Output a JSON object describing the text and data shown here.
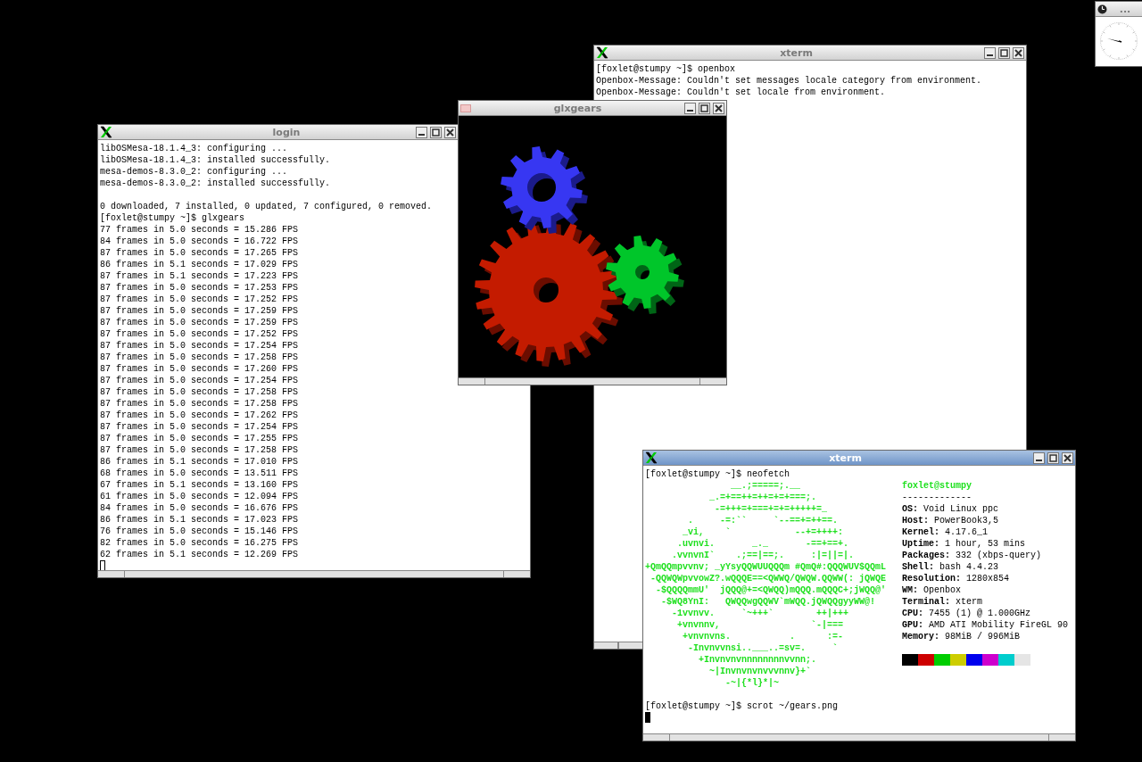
{
  "windows": [
    {
      "kind": "terminal",
      "title": "xterm",
      "active": false,
      "blocks": [
        [
          "[foxlet@stumpy ~]$ openbox",
          "Openbox-Message: Couldn't set messages locale category from environment.",
          "Openbox-Message: Couldn't set locale from environment."
        ]
      ]
    },
    {
      "kind": "terminal",
      "title": "login",
      "active": false,
      "cursor": true,
      "blocks": [
        [
          "libOSMesa-18.1.4_3: configuring ...",
          "libOSMesa-18.1.4_3: installed successfully.",
          "mesa-demos-8.3.0_2: configuring ...",
          "mesa-demos-8.3.0_2: installed successfully."
        ],
        [
          "0 downloaded, 7 installed, 0 updated, 7 configured, 0 removed.",
          "[foxlet@stumpy ~]$ glxgears",
          "77 frames in 5.0 seconds = 15.286 FPS",
          "84 frames in 5.0 seconds = 16.722 FPS",
          "87 frames in 5.0 seconds = 17.265 FPS",
          "86 frames in 5.1 seconds = 17.029 FPS",
          "87 frames in 5.1 seconds = 17.223 FPS",
          "87 frames in 5.0 seconds = 17.253 FPS",
          "87 frames in 5.0 seconds = 17.252 FPS",
          "87 frames in 5.0 seconds = 17.259 FPS",
          "87 frames in 5.0 seconds = 17.259 FPS",
          "87 frames in 5.0 seconds = 17.252 FPS",
          "87 frames in 5.0 seconds = 17.254 FPS",
          "87 frames in 5.0 seconds = 17.258 FPS",
          "87 frames in 5.0 seconds = 17.260 FPS",
          "87 frames in 5.0 seconds = 17.254 FPS",
          "87 frames in 5.0 seconds = 17.258 FPS",
          "87 frames in 5.0 seconds = 17.258 FPS",
          "87 frames in 5.0 seconds = 17.262 FPS",
          "87 frames in 5.0 seconds = 17.254 FPS",
          "87 frames in 5.0 seconds = 17.255 FPS",
          "87 frames in 5.0 seconds = 17.258 FPS",
          "86 frames in 5.1 seconds = 17.010 FPS",
          "68 frames in 5.0 seconds = 13.511 FPS",
          "67 frames in 5.1 seconds = 13.160 FPS",
          "61 frames in 5.0 seconds = 12.094 FPS",
          "84 frames in 5.0 seconds = 16.676 FPS",
          "86 frames in 5.1 seconds = 17.023 FPS",
          "76 frames in 5.0 seconds = 15.146 FPS",
          "82 frames in 5.0 seconds = 16.275 FPS",
          "62 frames in 5.1 seconds = 12.269 FPS"
        ]
      ]
    },
    {
      "kind": "gears",
      "title": "glxgears",
      "active": false
    },
    {
      "kind": "neofetch",
      "title": "xterm",
      "active": true,
      "cursor": true,
      "prompt": "[foxlet@stumpy ~]$ neofetch",
      "art": [
        "                __.;=====;.__",
        "            _.=+==++=++=+=+===;.",
        "             -=+++=+===+=+=+++++=_",
        "        .     -=:``     `--==+=++==.",
        "       _vi,    `            --+=++++:",
        "      .uvnvi.       _._       -==+==+.",
        "     .vvnvnI`    .;==|==;.     :|=||=|.",
        "+QmQQmpvvnv; _yYsyQQWUUQQQm #QmQ#:QQQWUV$QQmL",
        " -QQWQWpvvowZ?.wQQQE==<QWWQ/QWQW.QQWW(: jQWQE",
        "  -$QQQQmmU'  jQQQ@+=<QWQQ)mQQQ.mQQQC+;jWQQ@'",
        "   -$WQ8YnI:   QWQQwgQQWV`mWQQ.jQWQQgyyWW@!",
        "     -1vvnvv.     `~+++`        ++|+++",
        "      +vnvnnv,                 `-|===",
        "       +vnvnvns.           .      :=-",
        "        -Invnvvnsi..___..=sv=.     `",
        "          +Invnvnvnnnnnnnnvvnn;.",
        "            ~|Invnvnvnvvvnnv}+`",
        "               -~|{*l}*|~"
      ],
      "user": "foxlet@stumpy",
      "separator": "-------------",
      "info": [
        "**OS:** Void Linux ppc",
        "**Host:** PowerBook3,5",
        "**Kernel:** 4.17.6_1",
        "**Uptime:** 1 hour, 53 mins",
        "**Packages:** 332 (xbps-query)",
        "**Shell:** bash 4.4.23",
        "**Resolution:** 1280x854",
        "**WM:** Openbox",
        "**Terminal:** xterm",
        "**CPU:** 7455 (1) @ 1.000GHz",
        "**GPU:** AMD ATI Mobility FireGL 90",
        "**Memory:** 98MiB / 996MiB"
      ],
      "palette": [
        {
          "color": "#000000"
        },
        {
          "color": "#cd0000"
        },
        {
          "color": "#00cd00"
        },
        {
          "color": "#cdcd00"
        },
        {
          "color": "#0000ee"
        },
        {
          "color": "#cd00cd"
        },
        {
          "color": "#00cdcd"
        },
        {
          "color": "#e5e5e5"
        }
      ],
      "after": [
        "[foxlet@stumpy ~]$ scrot ~/gears.png"
      ]
    },
    {
      "kind": "clock",
      "title": "...",
      "active": false
    }
  ]
}
